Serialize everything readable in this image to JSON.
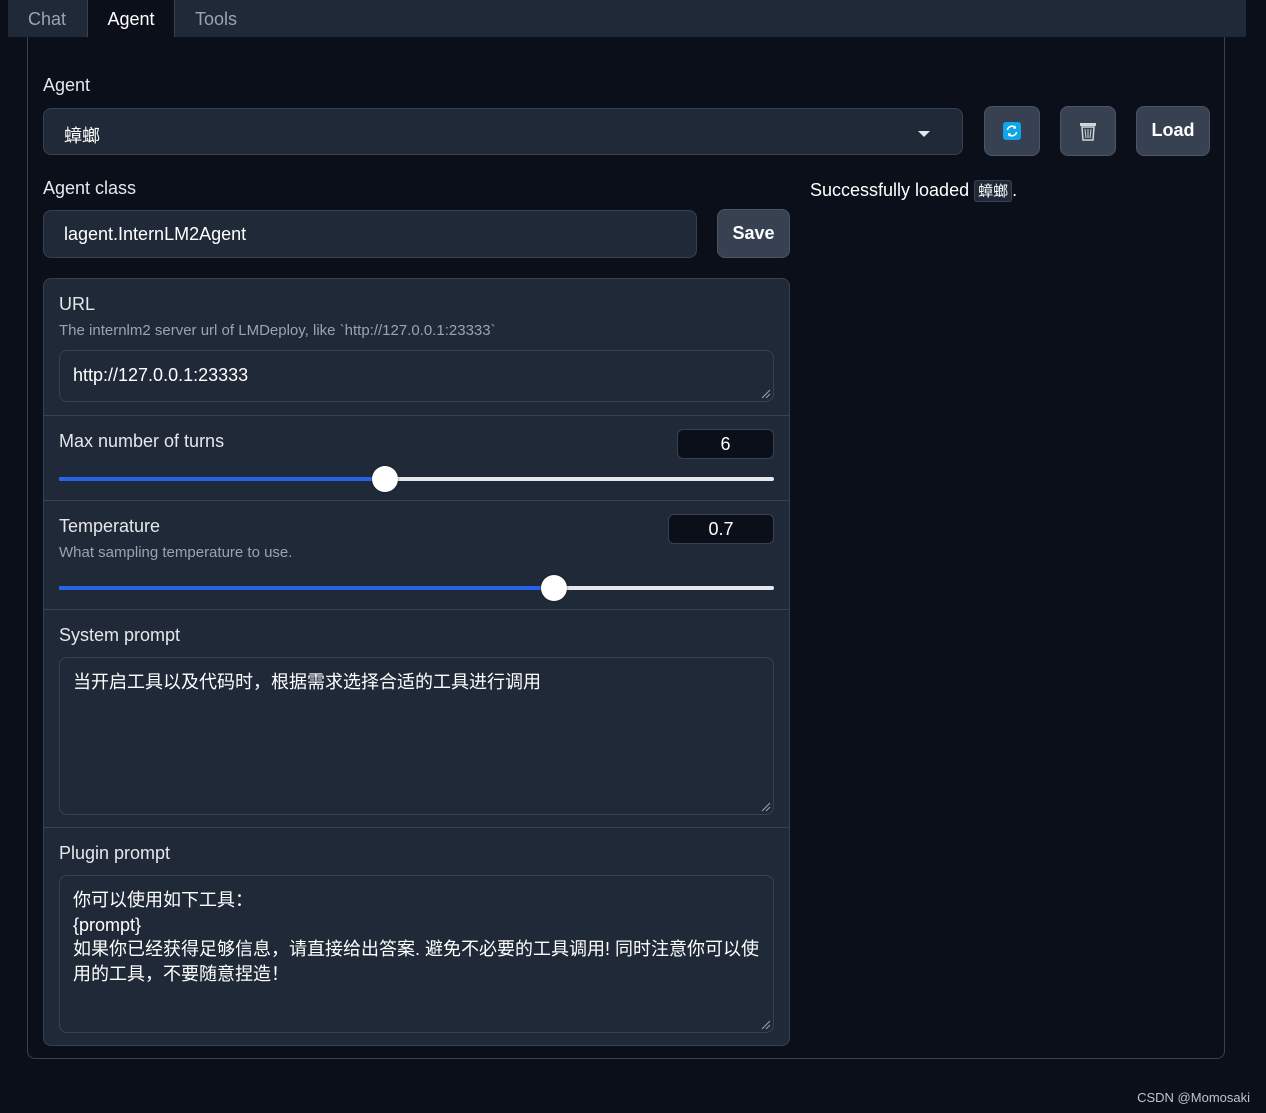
{
  "tabs": [
    {
      "label": "Chat",
      "active": false
    },
    {
      "label": "Agent",
      "active": true
    },
    {
      "label": "Tools",
      "active": false
    }
  ],
  "agent": {
    "label": "Agent",
    "selected": "蟑螂",
    "load_label": "Load",
    "refresh_icon": "refresh-icon",
    "delete_icon": "trash-icon"
  },
  "agent_class": {
    "label": "Agent class",
    "value": "lagent.InternLM2Agent",
    "save_label": "Save"
  },
  "status": {
    "prefix": "Successfully loaded ",
    "name": "蟑螂",
    "suffix": "."
  },
  "url": {
    "label": "URL",
    "hint": "The internlm2 server url of LMDeploy, like `http://127.0.0.1:23333`",
    "value": "http://127.0.0.1:23333"
  },
  "max_turns": {
    "label": "Max number of turns",
    "value": "6",
    "fraction": 0.456
  },
  "temperature": {
    "label": "Temperature",
    "hint": "What sampling temperature to use.",
    "value": "0.7",
    "fraction": 0.692
  },
  "system_prompt": {
    "label": "System prompt",
    "value": "当开启工具以及代码时，根据需求选择合适的工具进行调用"
  },
  "plugin_prompt": {
    "label": "Plugin prompt",
    "value": "你可以使用如下工具：\n{prompt}\n如果你已经获得足够信息，请直接给出答案. 避免不必要的工具调用! 同时注意你可以使用的工具，不要随意捏造！"
  },
  "footer": "CSDN @Momosaki",
  "colors": {
    "accent": "#2563eb",
    "background": "#0b0f19",
    "panel": "#1f2937"
  }
}
